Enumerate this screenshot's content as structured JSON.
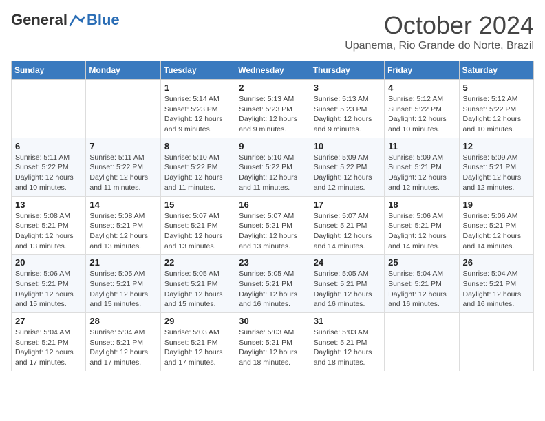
{
  "logo": {
    "general": "General",
    "blue": "Blue"
  },
  "title": "October 2024",
  "location": "Upanema, Rio Grande do Norte, Brazil",
  "headers": [
    "Sunday",
    "Monday",
    "Tuesday",
    "Wednesday",
    "Thursday",
    "Friday",
    "Saturday"
  ],
  "weeks": [
    [
      {
        "day": "",
        "info": ""
      },
      {
        "day": "",
        "info": ""
      },
      {
        "day": "1",
        "info": "Sunrise: 5:14 AM\nSunset: 5:23 PM\nDaylight: 12 hours and 9 minutes."
      },
      {
        "day": "2",
        "info": "Sunrise: 5:13 AM\nSunset: 5:23 PM\nDaylight: 12 hours and 9 minutes."
      },
      {
        "day": "3",
        "info": "Sunrise: 5:13 AM\nSunset: 5:23 PM\nDaylight: 12 hours and 9 minutes."
      },
      {
        "day": "4",
        "info": "Sunrise: 5:12 AM\nSunset: 5:22 PM\nDaylight: 12 hours and 10 minutes."
      },
      {
        "day": "5",
        "info": "Sunrise: 5:12 AM\nSunset: 5:22 PM\nDaylight: 12 hours and 10 minutes."
      }
    ],
    [
      {
        "day": "6",
        "info": "Sunrise: 5:11 AM\nSunset: 5:22 PM\nDaylight: 12 hours and 10 minutes."
      },
      {
        "day": "7",
        "info": "Sunrise: 5:11 AM\nSunset: 5:22 PM\nDaylight: 12 hours and 11 minutes."
      },
      {
        "day": "8",
        "info": "Sunrise: 5:10 AM\nSunset: 5:22 PM\nDaylight: 12 hours and 11 minutes."
      },
      {
        "day": "9",
        "info": "Sunrise: 5:10 AM\nSunset: 5:22 PM\nDaylight: 12 hours and 11 minutes."
      },
      {
        "day": "10",
        "info": "Sunrise: 5:09 AM\nSunset: 5:22 PM\nDaylight: 12 hours and 12 minutes."
      },
      {
        "day": "11",
        "info": "Sunrise: 5:09 AM\nSunset: 5:21 PM\nDaylight: 12 hours and 12 minutes."
      },
      {
        "day": "12",
        "info": "Sunrise: 5:09 AM\nSunset: 5:21 PM\nDaylight: 12 hours and 12 minutes."
      }
    ],
    [
      {
        "day": "13",
        "info": "Sunrise: 5:08 AM\nSunset: 5:21 PM\nDaylight: 12 hours and 13 minutes."
      },
      {
        "day": "14",
        "info": "Sunrise: 5:08 AM\nSunset: 5:21 PM\nDaylight: 12 hours and 13 minutes."
      },
      {
        "day": "15",
        "info": "Sunrise: 5:07 AM\nSunset: 5:21 PM\nDaylight: 12 hours and 13 minutes."
      },
      {
        "day": "16",
        "info": "Sunrise: 5:07 AM\nSunset: 5:21 PM\nDaylight: 12 hours and 13 minutes."
      },
      {
        "day": "17",
        "info": "Sunrise: 5:07 AM\nSunset: 5:21 PM\nDaylight: 12 hours and 14 minutes."
      },
      {
        "day": "18",
        "info": "Sunrise: 5:06 AM\nSunset: 5:21 PM\nDaylight: 12 hours and 14 minutes."
      },
      {
        "day": "19",
        "info": "Sunrise: 5:06 AM\nSunset: 5:21 PM\nDaylight: 12 hours and 14 minutes."
      }
    ],
    [
      {
        "day": "20",
        "info": "Sunrise: 5:06 AM\nSunset: 5:21 PM\nDaylight: 12 hours and 15 minutes."
      },
      {
        "day": "21",
        "info": "Sunrise: 5:05 AM\nSunset: 5:21 PM\nDaylight: 12 hours and 15 minutes."
      },
      {
        "day": "22",
        "info": "Sunrise: 5:05 AM\nSunset: 5:21 PM\nDaylight: 12 hours and 15 minutes."
      },
      {
        "day": "23",
        "info": "Sunrise: 5:05 AM\nSunset: 5:21 PM\nDaylight: 12 hours and 16 minutes."
      },
      {
        "day": "24",
        "info": "Sunrise: 5:05 AM\nSunset: 5:21 PM\nDaylight: 12 hours and 16 minutes."
      },
      {
        "day": "25",
        "info": "Sunrise: 5:04 AM\nSunset: 5:21 PM\nDaylight: 12 hours and 16 minutes."
      },
      {
        "day": "26",
        "info": "Sunrise: 5:04 AM\nSunset: 5:21 PM\nDaylight: 12 hours and 16 minutes."
      }
    ],
    [
      {
        "day": "27",
        "info": "Sunrise: 5:04 AM\nSunset: 5:21 PM\nDaylight: 12 hours and 17 minutes."
      },
      {
        "day": "28",
        "info": "Sunrise: 5:04 AM\nSunset: 5:21 PM\nDaylight: 12 hours and 17 minutes."
      },
      {
        "day": "29",
        "info": "Sunrise: 5:03 AM\nSunset: 5:21 PM\nDaylight: 12 hours and 17 minutes."
      },
      {
        "day": "30",
        "info": "Sunrise: 5:03 AM\nSunset: 5:21 PM\nDaylight: 12 hours and 18 minutes."
      },
      {
        "day": "31",
        "info": "Sunrise: 5:03 AM\nSunset: 5:21 PM\nDaylight: 12 hours and 18 minutes."
      },
      {
        "day": "",
        "info": ""
      },
      {
        "day": "",
        "info": ""
      }
    ]
  ]
}
